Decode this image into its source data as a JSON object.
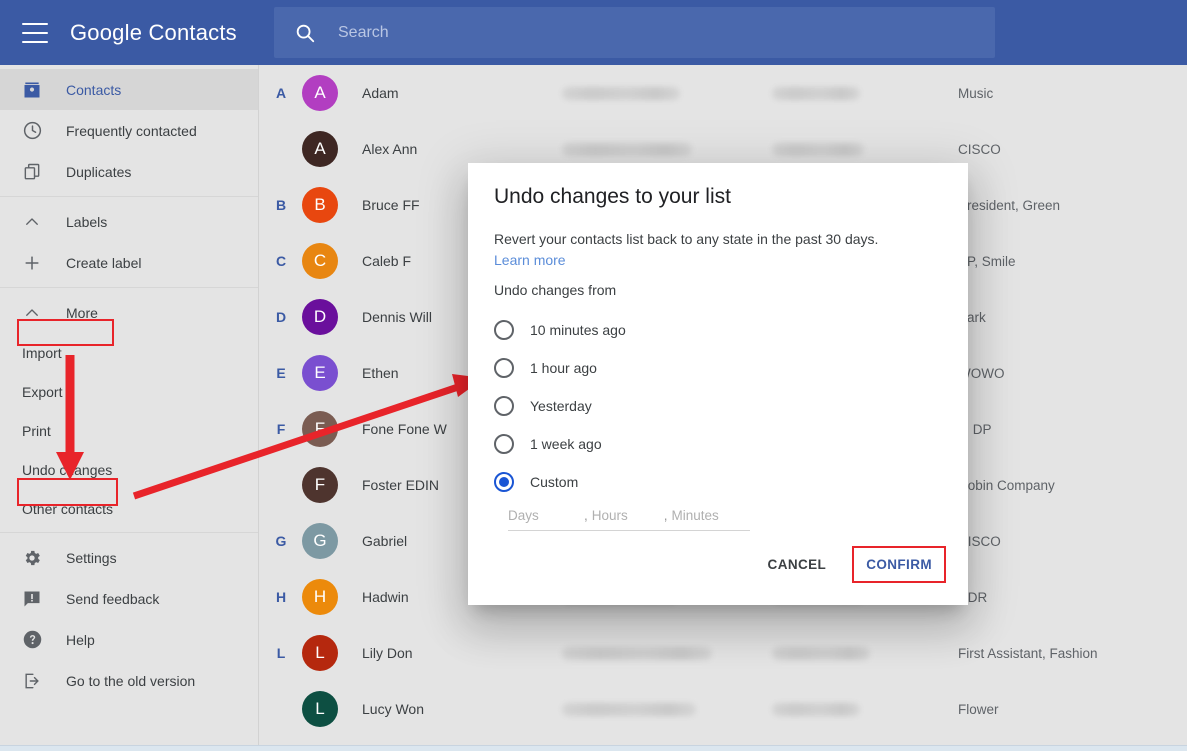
{
  "header": {
    "menu_icon": "hamburger-menu-icon",
    "brand_first": "Google",
    "brand_second": "Contacts",
    "search_icon": "search-icon",
    "search_placeholder": "Search",
    "search_value": "",
    "bg_color": "#3b5aa4",
    "search_bg_color": "#4a68ad"
  },
  "sidebar": {
    "groups": [
      {
        "items": [
          {
            "label": "Contacts",
            "icon": "contact-card-icon",
            "active": true
          },
          {
            "label": "Frequently contacted",
            "icon": "history-clock-icon",
            "active": false
          },
          {
            "label": "Duplicates",
            "icon": "duplicate-copy-icon",
            "active": false
          }
        ]
      },
      {
        "items": [
          {
            "label": "Labels",
            "icon": "chevron-up-icon",
            "active": false
          },
          {
            "label": "Create label",
            "icon": "plus-icon",
            "active": false
          }
        ]
      },
      {
        "items": [
          {
            "label": "More",
            "icon": "chevron-up-icon",
            "active": false
          }
        ],
        "sub_items": [
          {
            "label": "Import"
          },
          {
            "label": "Export"
          },
          {
            "label": "Print"
          },
          {
            "label": "Undo changes"
          },
          {
            "label": "Other contacts"
          }
        ]
      },
      {
        "items": [
          {
            "label": "Settings",
            "icon": "gear-icon",
            "active": false
          },
          {
            "label": "Send feedback",
            "icon": "feedback-icon",
            "active": false
          },
          {
            "label": "Help",
            "icon": "help-question-icon",
            "active": false
          },
          {
            "label": "Go to the old version",
            "icon": "exit-arrow-icon",
            "active": false
          }
        ]
      }
    ]
  },
  "contacts": [
    {
      "letter": "A",
      "initial": "A",
      "name": "Adam",
      "company": "Music",
      "avatar_color": "#b23ec1",
      "email_redacted": true,
      "phone_redacted": true
    },
    {
      "letter": "",
      "initial": "A",
      "name": "Alex Ann",
      "company": "CISCO",
      "avatar_color": "#3e2723",
      "email_redacted": true,
      "phone_redacted": true
    },
    {
      "letter": "B",
      "initial": "B",
      "name": "Bruce FF",
      "company": "President, Green",
      "avatar_color": "#e8470f",
      "email_redacted": true,
      "phone_redacted": true
    },
    {
      "letter": "C",
      "initial": "C",
      "name": "Caleb F",
      "company": "VP, Smile",
      "avatar_color": "#e88611",
      "email_redacted": true,
      "phone_redacted": true
    },
    {
      "letter": "D",
      "initial": "D",
      "name": "Dennis Will",
      "company": "Park",
      "avatar_color": "#6a0f9c",
      "email_redacted": true,
      "phone_redacted": true
    },
    {
      "letter": "E",
      "initial": "E",
      "name": "Ethen",
      "company": "WOWO",
      "avatar_color": "#7a4fd0",
      "email_redacted": true,
      "phone_redacted": true
    },
    {
      "letter": "F",
      "initial": "F",
      "name": "Fone Fone W",
      "company": "P, DP",
      "avatar_color": "#7a5c52",
      "email_redacted": true,
      "phone_redacted": true
    },
    {
      "letter": "",
      "initial": "F",
      "name": "Foster EDIN",
      "company": "Robin Company",
      "avatar_color": "#4e342e",
      "email_redacted": true,
      "phone_redacted": true
    },
    {
      "letter": "G",
      "initial": "G",
      "name": "Gabriel",
      "company": "CISCO",
      "avatar_color": "#7d99a3",
      "email_redacted": true,
      "phone_redacted": true
    },
    {
      "letter": "H",
      "initial": "H",
      "name": "Hadwin",
      "company": "HDR",
      "avatar_color": "#ec8a0b",
      "email_redacted": true,
      "phone_redacted": true
    },
    {
      "letter": "L",
      "initial": "L",
      "name": "Lily Don",
      "company": "First Assistant, Fashion",
      "avatar_color": "#b5280e",
      "email_redacted": true,
      "phone_redacted": true
    },
    {
      "letter": "",
      "initial": "L",
      "name": "Lucy Won",
      "company": "Flower",
      "avatar_color": "#0d4f42",
      "email_redacted": true,
      "phone_redacted": true
    }
  ],
  "dialog": {
    "title": "Undo changes to your list",
    "description": "Revert your contacts list back to any state in the past 30 days.",
    "learn_more": "Learn more",
    "section_label": "Undo changes from",
    "options": [
      {
        "label": "10 minutes ago",
        "selected": false
      },
      {
        "label": "1 hour ago",
        "selected": false
      },
      {
        "label": "Yesterday",
        "selected": false
      },
      {
        "label": "1 week ago",
        "selected": false
      },
      {
        "label": "Custom",
        "selected": true
      }
    ],
    "custom_fields": {
      "days_placeholder": "Days",
      "days_value": "",
      "hours_placeholder": "Hours",
      "hours_value": "",
      "minutes_placeholder": "Minutes",
      "minutes_value": "",
      "separator": ","
    },
    "cancel_label": "CANCEL",
    "confirm_label": "CONFIRM",
    "link_color": "#5b8dd9",
    "accent_color": "#1a55d4"
  },
  "annotations": {
    "highlight_color": "#e8242a",
    "highlighted": [
      "More",
      "Undo changes",
      "CONFIRM"
    ],
    "arrow_down": "Import/Export/Print down to Undo changes",
    "arrow_diagonal": "Undo changes to dialog"
  }
}
